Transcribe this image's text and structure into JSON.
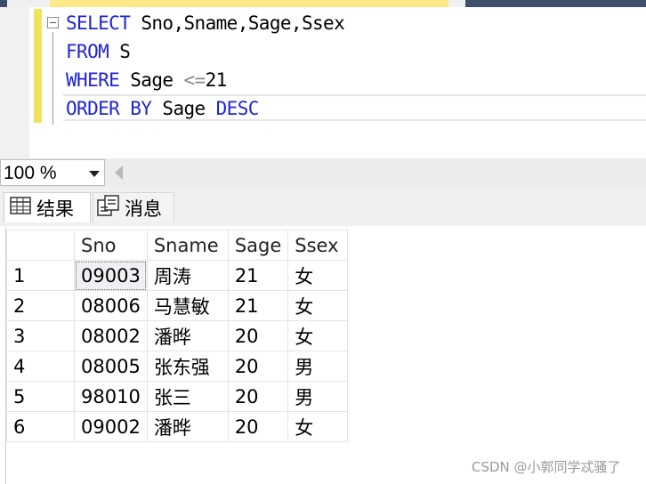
{
  "editor": {
    "lines": [
      {
        "kw": "SELECT",
        "rest": "Sno,Sname,Sage,Ssex"
      },
      {
        "kw": "FROM",
        "rest": "S"
      },
      {
        "kw": "WHERE",
        "rest_pre": "Sage ",
        "op": "<=",
        "rest_post": "21"
      },
      {
        "kw": "ORDER BY",
        "rest": "Sage",
        "kw2": "DESC"
      }
    ]
  },
  "zoom": {
    "value": "100 %"
  },
  "tabs": {
    "results_label": "结果",
    "messages_label": "消息"
  },
  "grid": {
    "columns": [
      "Sno",
      "Sname",
      "Sage",
      "Ssex"
    ],
    "rows": [
      {
        "n": "1",
        "Sno": "09003",
        "Sname": "周涛",
        "Sage": "21",
        "Ssex": "女"
      },
      {
        "n": "2",
        "Sno": "08006",
        "Sname": "马慧敏",
        "Sage": "21",
        "Ssex": "女"
      },
      {
        "n": "3",
        "Sno": "08002",
        "Sname": "潘晔",
        "Sage": "20",
        "Ssex": "女"
      },
      {
        "n": "4",
        "Sno": "08005",
        "Sname": "张东强",
        "Sage": "20",
        "Ssex": "男"
      },
      {
        "n": "5",
        "Sno": "98010",
        "Sname": "张三",
        "Sage": "20",
        "Ssex": "男"
      },
      {
        "n": "6",
        "Sno": "09002",
        "Sname": "潘晔",
        "Sage": "20",
        "Ssex": "女"
      }
    ]
  },
  "watermark": "CSDN @小郭同学忒骚了",
  "colors": {
    "keyword": "#1f24d4",
    "change_bar": "#f2e35f"
  }
}
